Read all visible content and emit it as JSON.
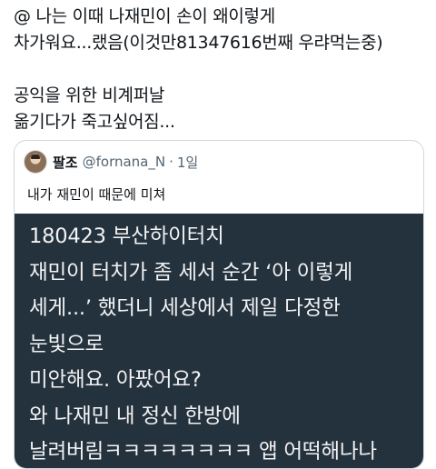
{
  "tweet": {
    "lines": [
      "@ 나는 이때 나재민이 손이 왜이렇게",
      "차가워요...랬음(이것만81347616번째 우랴먹는중)",
      "",
      "공익을 위한 비계퍼날",
      "옮기다가 죽고싶어짐..."
    ]
  },
  "quote": {
    "name": "팔조",
    "handle": "@fornana_N",
    "separator": "·",
    "time": "1일",
    "text": "내가 재민이 때문에 미쳐",
    "image_lines": [
      "180423 부산하이터치",
      "재민이 터치가 좀 세서 순간 ‘아 이렇게",
      "세게...’ 했더니 세상에서 제일 다정한",
      "눈빛으로",
      "미안해요. 아팠어요?",
      "와 나재민 내 정신 한방에",
      "날려버림ㅋㅋㅋㅋㅋㅋㅋㅋ 앱 어떡해나나"
    ]
  }
}
